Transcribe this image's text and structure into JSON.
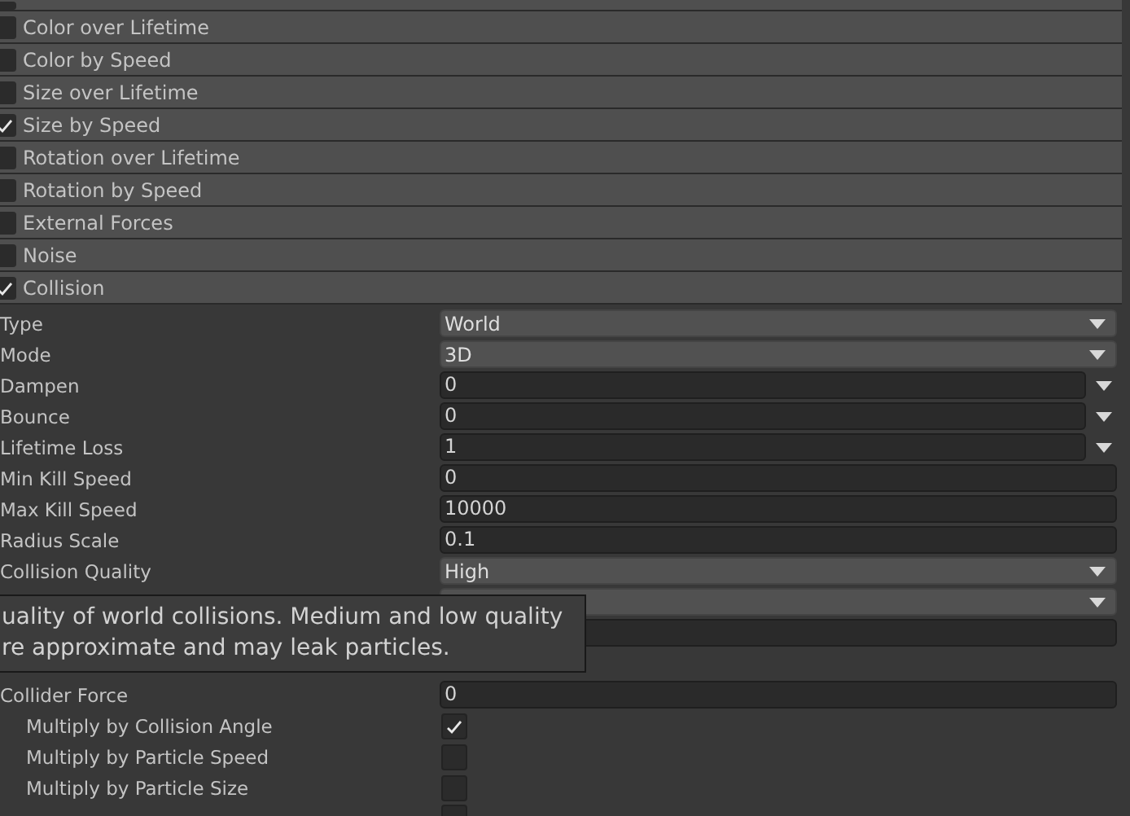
{
  "modules": [
    {
      "checked": false
    },
    {
      "label": "Color over Lifetime",
      "checked": false
    },
    {
      "label": "Color by Speed",
      "checked": false
    },
    {
      "label": "Size over Lifetime",
      "checked": false
    },
    {
      "label": "Size by Speed",
      "checked": true
    },
    {
      "label": "Rotation over Lifetime",
      "checked": false
    },
    {
      "label": "Rotation by Speed",
      "checked": false
    },
    {
      "label": "External Forces",
      "checked": false
    },
    {
      "label": "Noise",
      "checked": false
    },
    {
      "label": "Collision",
      "checked": true
    }
  ],
  "properties": [
    {
      "label": "Type",
      "kind": "dropdown",
      "value": "World"
    },
    {
      "label": "Mode",
      "kind": "dropdown",
      "value": "3D"
    },
    {
      "label": "Dampen",
      "kind": "curve",
      "value": "0"
    },
    {
      "label": "Bounce",
      "kind": "curve",
      "value": "0"
    },
    {
      "label": "Lifetime Loss",
      "kind": "curve",
      "value": "1"
    },
    {
      "label": "Min Kill Speed",
      "kind": "field",
      "value": "0"
    },
    {
      "label": "Max Kill Speed",
      "kind": "field",
      "value": "10000"
    },
    {
      "label": "Radius Scale",
      "kind": "field",
      "value": "0.1"
    },
    {
      "label": "Collision Quality",
      "kind": "dropdown",
      "value": "High"
    },
    {
      "kind": "dropdown"
    },
    {
      "kind": "field"
    },
    {
      "kind": "blank"
    },
    {
      "label": "Collider Force",
      "kind": "field",
      "value": "0"
    },
    {
      "label": "Multiply by Collision Angle",
      "kind": "checkbox",
      "checked": true,
      "indent": true
    },
    {
      "label": "Multiply by Particle Speed",
      "kind": "checkbox",
      "checked": false,
      "indent": true
    },
    {
      "label": "Multiply by Particle Size",
      "kind": "checkbox",
      "checked": false,
      "indent": true
    },
    {
      "kind": "checkbox",
      "checked": false
    }
  ],
  "tooltip": {
    "lines": [
      "uality of world collisions. Medium and low quality",
      "re approximate and may leak particles."
    ]
  }
}
